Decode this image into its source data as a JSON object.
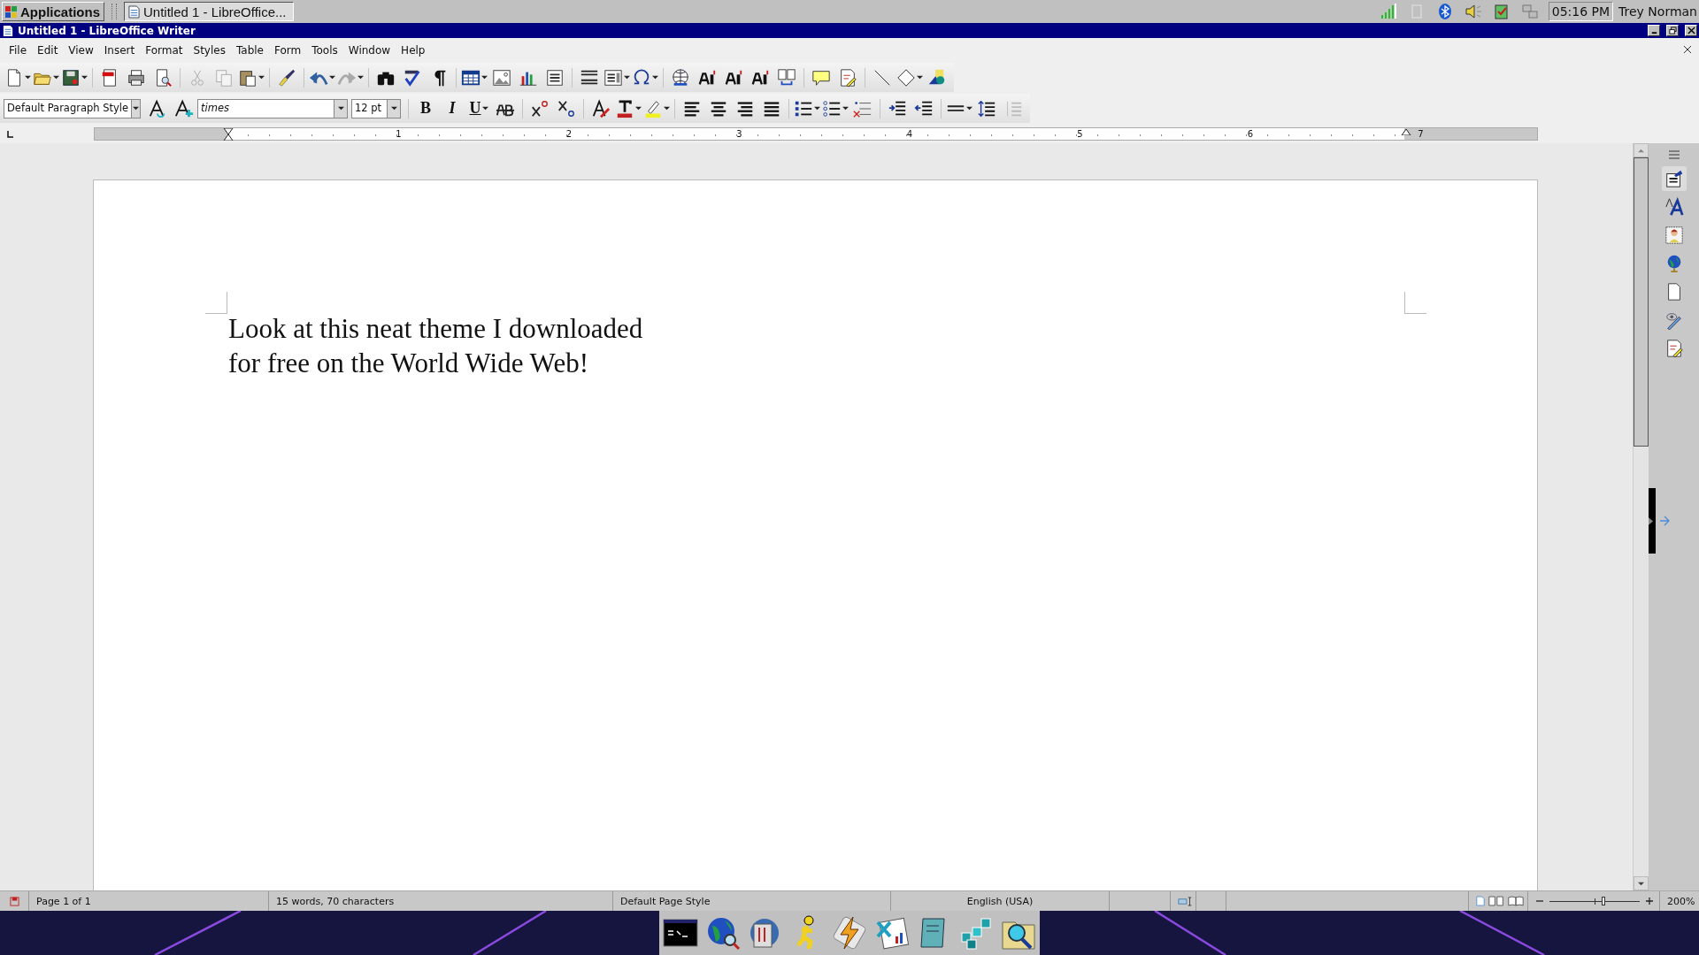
{
  "top_panel": {
    "applications": "Applications",
    "tasks": [
      {
        "label": "Untitled 1 - LibreOffice...",
        "selected": true
      }
    ],
    "clock": "05:16 PM",
    "user": "Trey Norman"
  },
  "window": {
    "title": "Untitled 1 - LibreOffice Writer"
  },
  "menu": [
    "File",
    "Edit",
    "View",
    "Insert",
    "Format",
    "Styles",
    "Table",
    "Form",
    "Tools",
    "Window",
    "Help"
  ],
  "formatting": {
    "paragraph_style": "Default Paragraph Style",
    "font_name": "times",
    "font_size": "12 pt",
    "text_buttons": [
      {
        "kind": "bold",
        "label": "B"
      },
      {
        "kind": "italic",
        "label": "I"
      },
      {
        "kind": "underline",
        "label": "U"
      }
    ]
  },
  "ruler": {
    "labels": [
      "1",
      "2",
      "3",
      "4",
      "5",
      "6",
      "7"
    ]
  },
  "document": {
    "paragraphs": [
      "Look at this neat theme I downloaded for free on the World Wide Web!"
    ]
  },
  "sidebar": {
    "tabs": [
      {
        "kind": "properties",
        "selected": true
      },
      {
        "kind": "styles",
        "selected": false
      },
      {
        "kind": "gallery",
        "selected": false
      },
      {
        "kind": "navigator",
        "selected": false
      },
      {
        "kind": "page",
        "selected": false
      },
      {
        "kind": "inspector",
        "selected": false
      },
      {
        "kind": "changes",
        "selected": false
      }
    ]
  },
  "status_bar": {
    "page": "Page 1 of 1",
    "words": "15 words, 70 characters",
    "page_style": "Default Page Style",
    "language": "English (USA)",
    "zoom": {
      "level": 0.6,
      "reading": "200%"
    }
  },
  "dock": [
    {
      "kind": "terminal"
    },
    {
      "kind": "globe"
    },
    {
      "kind": "files"
    },
    {
      "kind": "runner"
    },
    {
      "kind": "bolt"
    },
    {
      "kind": "spreadsheet"
    },
    {
      "kind": "notebook"
    },
    {
      "kind": "cubes"
    },
    {
      "kind": "search"
    }
  ]
}
